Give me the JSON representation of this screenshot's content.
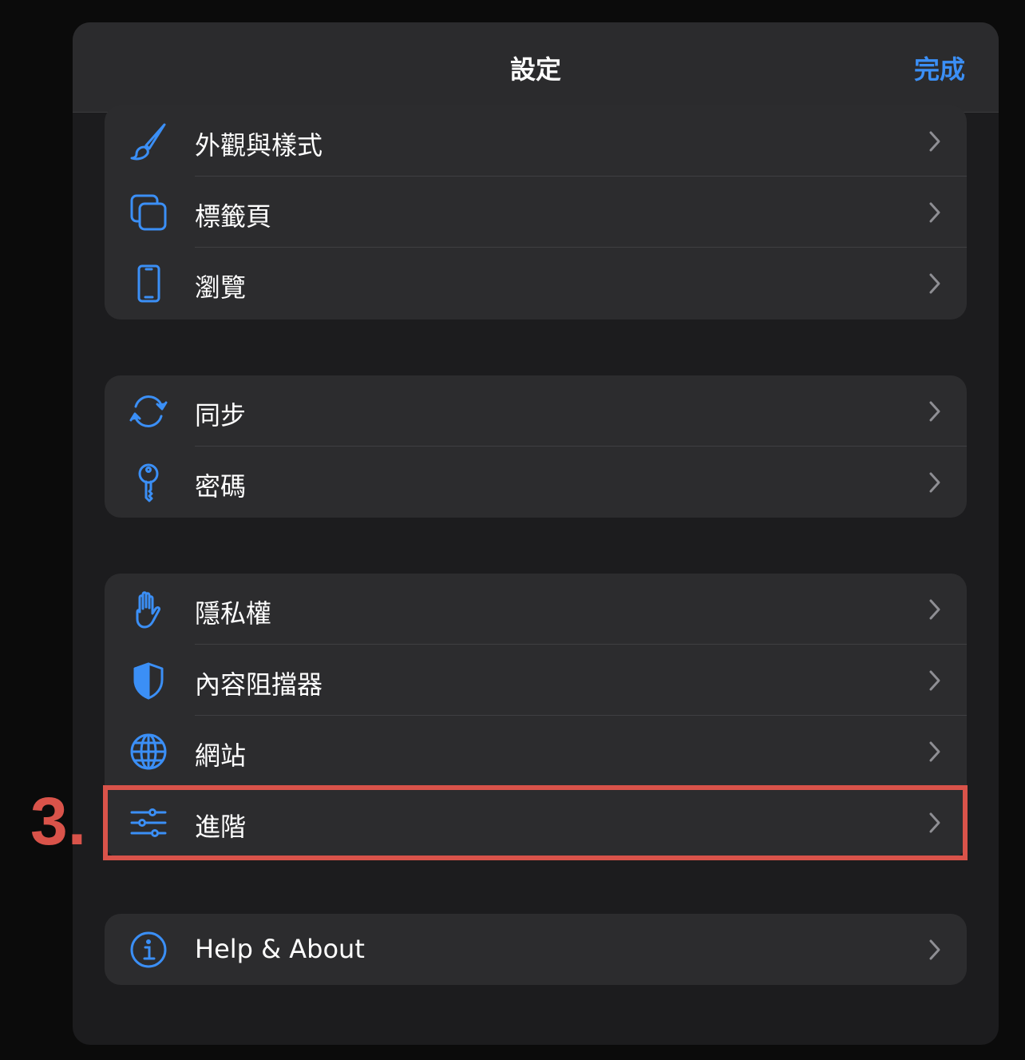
{
  "header": {
    "title": "設定",
    "done_label": "完成"
  },
  "groups": [
    {
      "items": [
        {
          "label": "外觀與樣式",
          "icon": "paintbrush-icon"
        },
        {
          "label": "標籤頁",
          "icon": "tabs-icon"
        },
        {
          "label": "瀏覽",
          "icon": "phone-icon"
        }
      ]
    },
    {
      "items": [
        {
          "label": "同步",
          "icon": "sync-icon"
        },
        {
          "label": "密碼",
          "icon": "key-icon"
        }
      ]
    },
    {
      "items": [
        {
          "label": "隱私權",
          "icon": "hand-icon"
        },
        {
          "label": "內容阻擋器",
          "icon": "shield-icon"
        },
        {
          "label": "網站",
          "icon": "globe-icon"
        },
        {
          "label": "進階",
          "icon": "sliders-icon"
        }
      ]
    },
    {
      "items": [
        {
          "label": "Help & About",
          "icon": "info-icon"
        }
      ]
    }
  ],
  "annotation": {
    "step_label": "3."
  },
  "colors": {
    "accent": "#3b8ff6",
    "highlight": "#d9534a",
    "background": "#1c1c1e",
    "cell": "#2c2c2e"
  }
}
